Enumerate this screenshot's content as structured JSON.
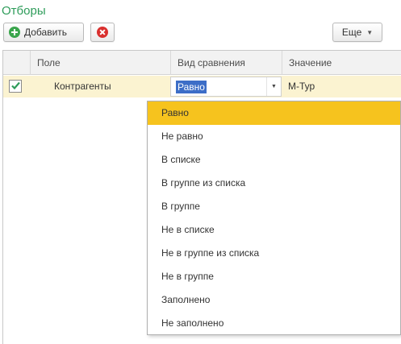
{
  "title": "Отборы",
  "toolbar": {
    "add_label": "Добавить",
    "more_label": "Еще",
    "more_caret": "▼"
  },
  "table": {
    "headers": {
      "field": "Поле",
      "comparison": "Вид сравнения",
      "value": "Значение"
    },
    "rows": [
      {
        "checked": true,
        "field": "Контрагенты",
        "comparison": "Равно",
        "value": "М-Тур"
      }
    ]
  },
  "dropdown": {
    "arrow": "▼",
    "selected_index": 0,
    "options": [
      "Равно",
      "Не равно",
      "В списке",
      "В группе из списка",
      "В группе",
      "Не в списке",
      "Не в группе из списка",
      "Не в группе",
      "Заполнено",
      "Не заполнено"
    ]
  },
  "colors": {
    "title_green": "#2e9c5a",
    "row_highlight": "#fbf3d1",
    "selection_blue": "#3d6ec7",
    "option_selected": "#f6c31e",
    "add_icon": "#3aa54c",
    "delete_icon": "#d9302e",
    "checkmark": "#2e9c5a"
  },
  "icons": {
    "add": "plus-circle-icon",
    "delete": "delete-circle-icon",
    "check": "checkmark-icon"
  }
}
